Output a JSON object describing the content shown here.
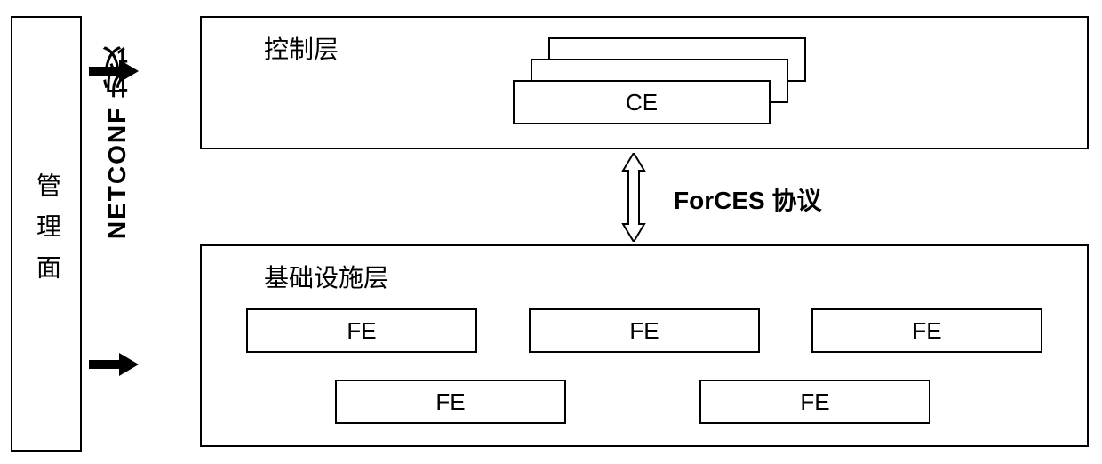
{
  "management_panel": {
    "label": "管理面"
  },
  "netconf": {
    "label": "NETCONF 协议"
  },
  "control_layer": {
    "title": "控制层",
    "ce_label": "CE"
  },
  "infra_layer": {
    "title": "基础设施层",
    "fe_label": "FE"
  },
  "forces": {
    "label": "ForCES 协议"
  }
}
